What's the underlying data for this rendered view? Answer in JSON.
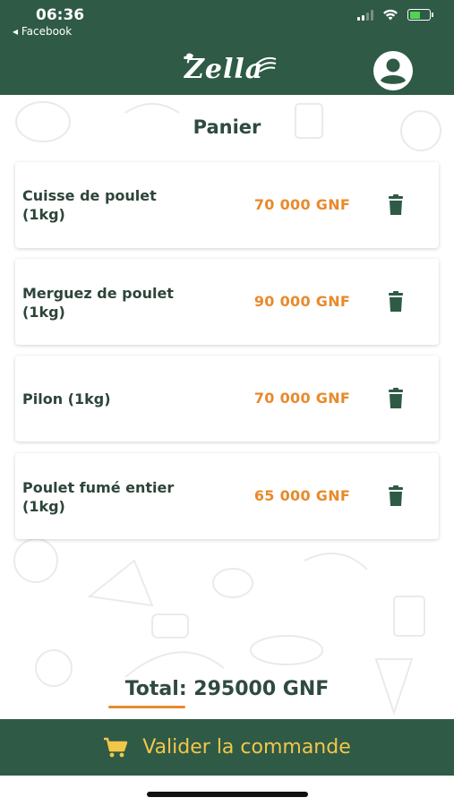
{
  "status_bar": {
    "time": "06:36",
    "back_label": "◂ Facebook"
  },
  "header": {
    "logo_text": "Zella",
    "profile_icon": "account-circle-icon"
  },
  "page": {
    "title": "Panier"
  },
  "cart": {
    "items": [
      {
        "name": "Cuisse de poulet (1kg)",
        "price": "70 000 GNF"
      },
      {
        "name": "Merguez de poulet (1kg)",
        "price": "90 000 GNF"
      },
      {
        "name": "Pilon (1kg)",
        "price": "70 000 GNF"
      },
      {
        "name": "Poulet fumé entier (1kg)",
        "price": "65 000 GNF"
      }
    ],
    "delete_icon": "trash-icon"
  },
  "summary": {
    "total_label": "Total: 295000 GNF"
  },
  "footer": {
    "validate_label": "Valider la commande",
    "cart_icon": "shopping-cart-icon"
  },
  "colors": {
    "brand_green": "#2f5a46",
    "price_orange": "#e88a2c",
    "button_text_yellow": "#f1c74a",
    "text_dark": "#2d4539"
  }
}
